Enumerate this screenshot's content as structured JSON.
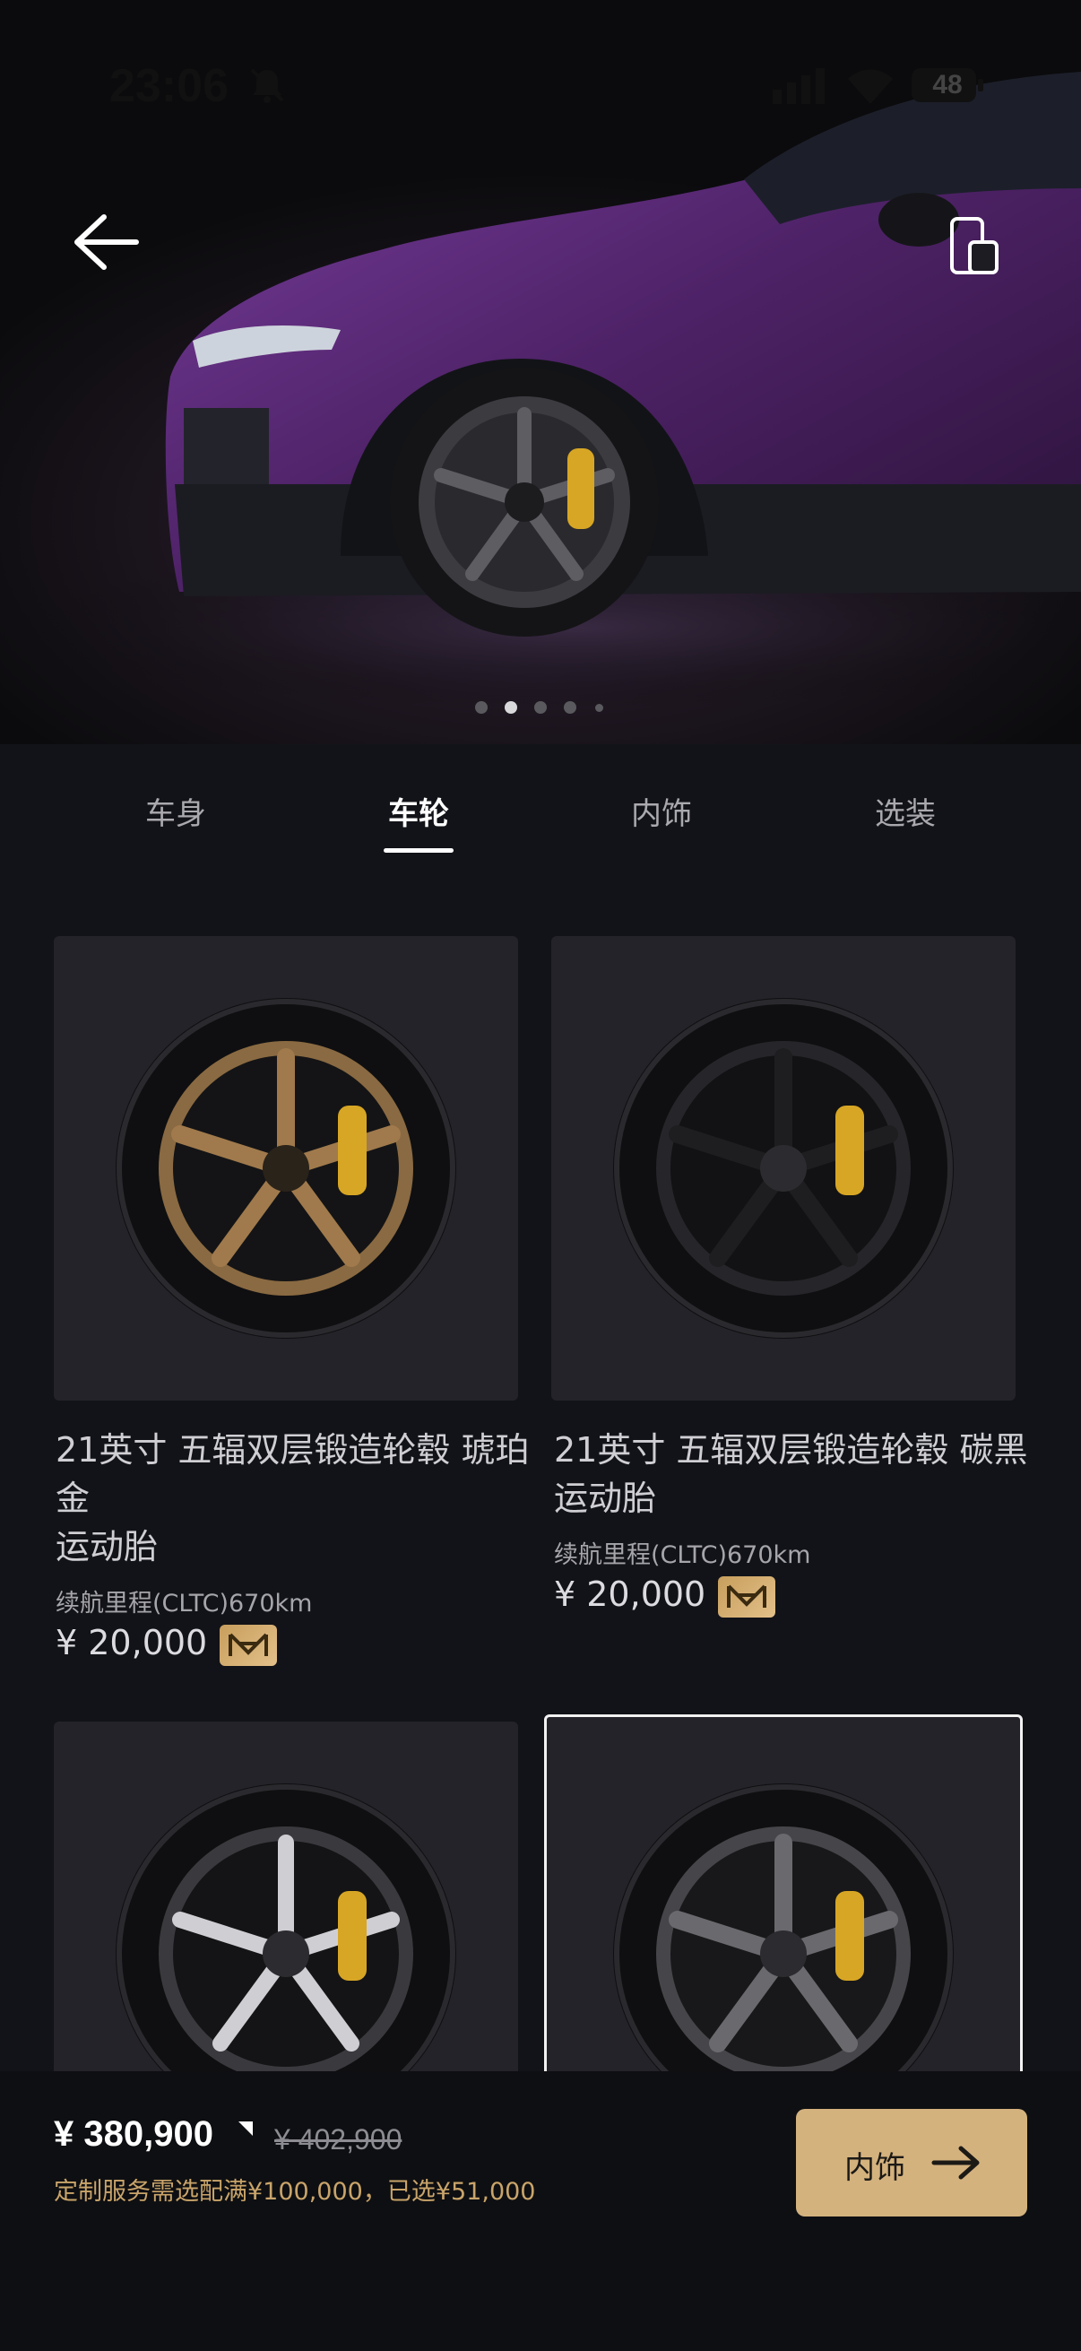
{
  "status": {
    "time": "23:06",
    "battery": "48"
  },
  "hero": {
    "slides": 5,
    "active_slide": 2
  },
  "tabs": [
    {
      "label": "车身"
    },
    {
      "label": "车轮"
    },
    {
      "label": "内饰"
    },
    {
      "label": "选装"
    }
  ],
  "active_tab": "车轮",
  "cards": [
    {
      "title_line1": "21英寸 五辐双层锻造轮毂 琥珀",
      "title_line2": "金",
      "title_line3": "运动胎",
      "range": "续航里程(CLTC)670km",
      "price": "¥ 20,000",
      "rim_color": "#a07a4c"
    },
    {
      "title_line1": "21英寸 五辐双层锻造轮毂 碳黑",
      "title_line2": "运动胎",
      "range": "续航里程(CLTC)670km",
      "price": "¥ 20,000",
      "rim_color": "#1a1a1c"
    },
    {
      "rim_color": "#3a3a3e",
      "accent": "#cfcfd3"
    },
    {
      "rim_color": "#4c4c50",
      "accent": "#8a8a8e",
      "selected": true
    }
  ],
  "footer": {
    "price": "¥ 380,900",
    "original_price": "¥ 402,900",
    "note": "定制服务需选配满¥100,000，已选¥51,000",
    "next_label": "内饰"
  },
  "colors": {
    "accent_gold": "#d4b27e",
    "car_purple": "#5b2d78",
    "caliper_yellow": "#d7a624"
  }
}
